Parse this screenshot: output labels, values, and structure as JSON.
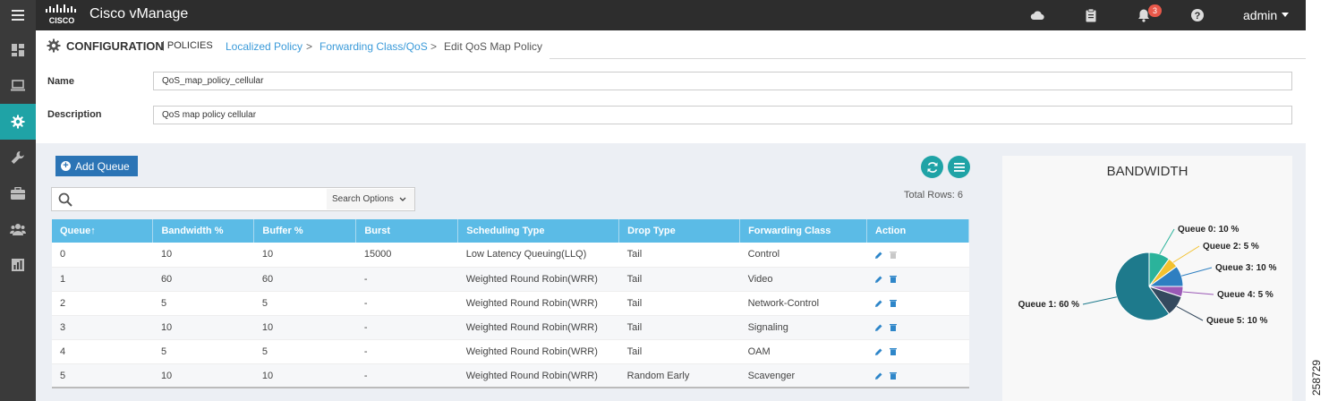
{
  "app": {
    "title": "Cisco vManage",
    "logo_text": "CISCO"
  },
  "topbar": {
    "notification_count": "3",
    "user": "admin"
  },
  "header": {
    "section": "CONFIGURATION",
    "subsection": "| POLICIES",
    "breadcrumb": [
      {
        "label": "Localized Policy",
        "link": true
      },
      {
        "label": "Forwarding Class/QoS",
        "link": true
      },
      {
        "label": "Edit QoS Map Policy",
        "link": false
      }
    ],
    "separator": ">"
  },
  "form": {
    "name_label": "Name",
    "name_value": "QoS_map_policy_cellular",
    "description_label": "Description",
    "description_value": "QoS map policy cellular"
  },
  "toolbar": {
    "add_queue_label": "Add Queue",
    "search_placeholder": "",
    "search_options_label": "Search Options",
    "total_rows": "Total Rows: 6"
  },
  "table": {
    "columns": [
      "Queue↑",
      "Bandwidth %",
      "Buffer %",
      "Burst",
      "Scheduling Type",
      "Drop Type",
      "Forwarding Class",
      "Action"
    ],
    "rows": [
      [
        "0",
        "10",
        "10",
        "15000",
        "Low Latency Queuing(LLQ)",
        "Tail",
        "Control"
      ],
      [
        "1",
        "60",
        "60",
        "-",
        "Weighted Round Robin(WRR)",
        "Tail",
        "Video"
      ],
      [
        "2",
        "5",
        "5",
        "-",
        "Weighted Round Robin(WRR)",
        "Tail",
        "Network-Control"
      ],
      [
        "3",
        "10",
        "10",
        "-",
        "Weighted Round Robin(WRR)",
        "Tail",
        "Signaling"
      ],
      [
        "4",
        "5",
        "5",
        "-",
        "Weighted Round Robin(WRR)",
        "Tail",
        "OAM"
      ],
      [
        "5",
        "10",
        "10",
        "-",
        "Weighted Round Robin(WRR)",
        "Random Early",
        "Scavenger"
      ]
    ]
  },
  "bandwidth": {
    "title": "BANDWIDTH",
    "slices": [
      {
        "label": "Queue 0: 10 %",
        "value": 10,
        "color": "#2bb39b"
      },
      {
        "label": "Queue 2: 5 %",
        "value": 5,
        "color": "#f2c12e"
      },
      {
        "label": "Queue 3: 10 %",
        "value": 10,
        "color": "#2e7fc1"
      },
      {
        "label": "Queue 4: 5 %",
        "value": 5,
        "color": "#9b59b6"
      },
      {
        "label": "Queue 5: 10 %",
        "value": 10,
        "color": "#34495e"
      },
      {
        "label": "Queue 1: 60 %",
        "value": 60,
        "color": "#1e7a8c"
      }
    ]
  },
  "colors": {
    "accent": "#1fa3a6",
    "header_bg": "#5bbbe6",
    "link": "#3a9ad9",
    "button": "#2b74b5"
  },
  "side_stamp": "258729"
}
